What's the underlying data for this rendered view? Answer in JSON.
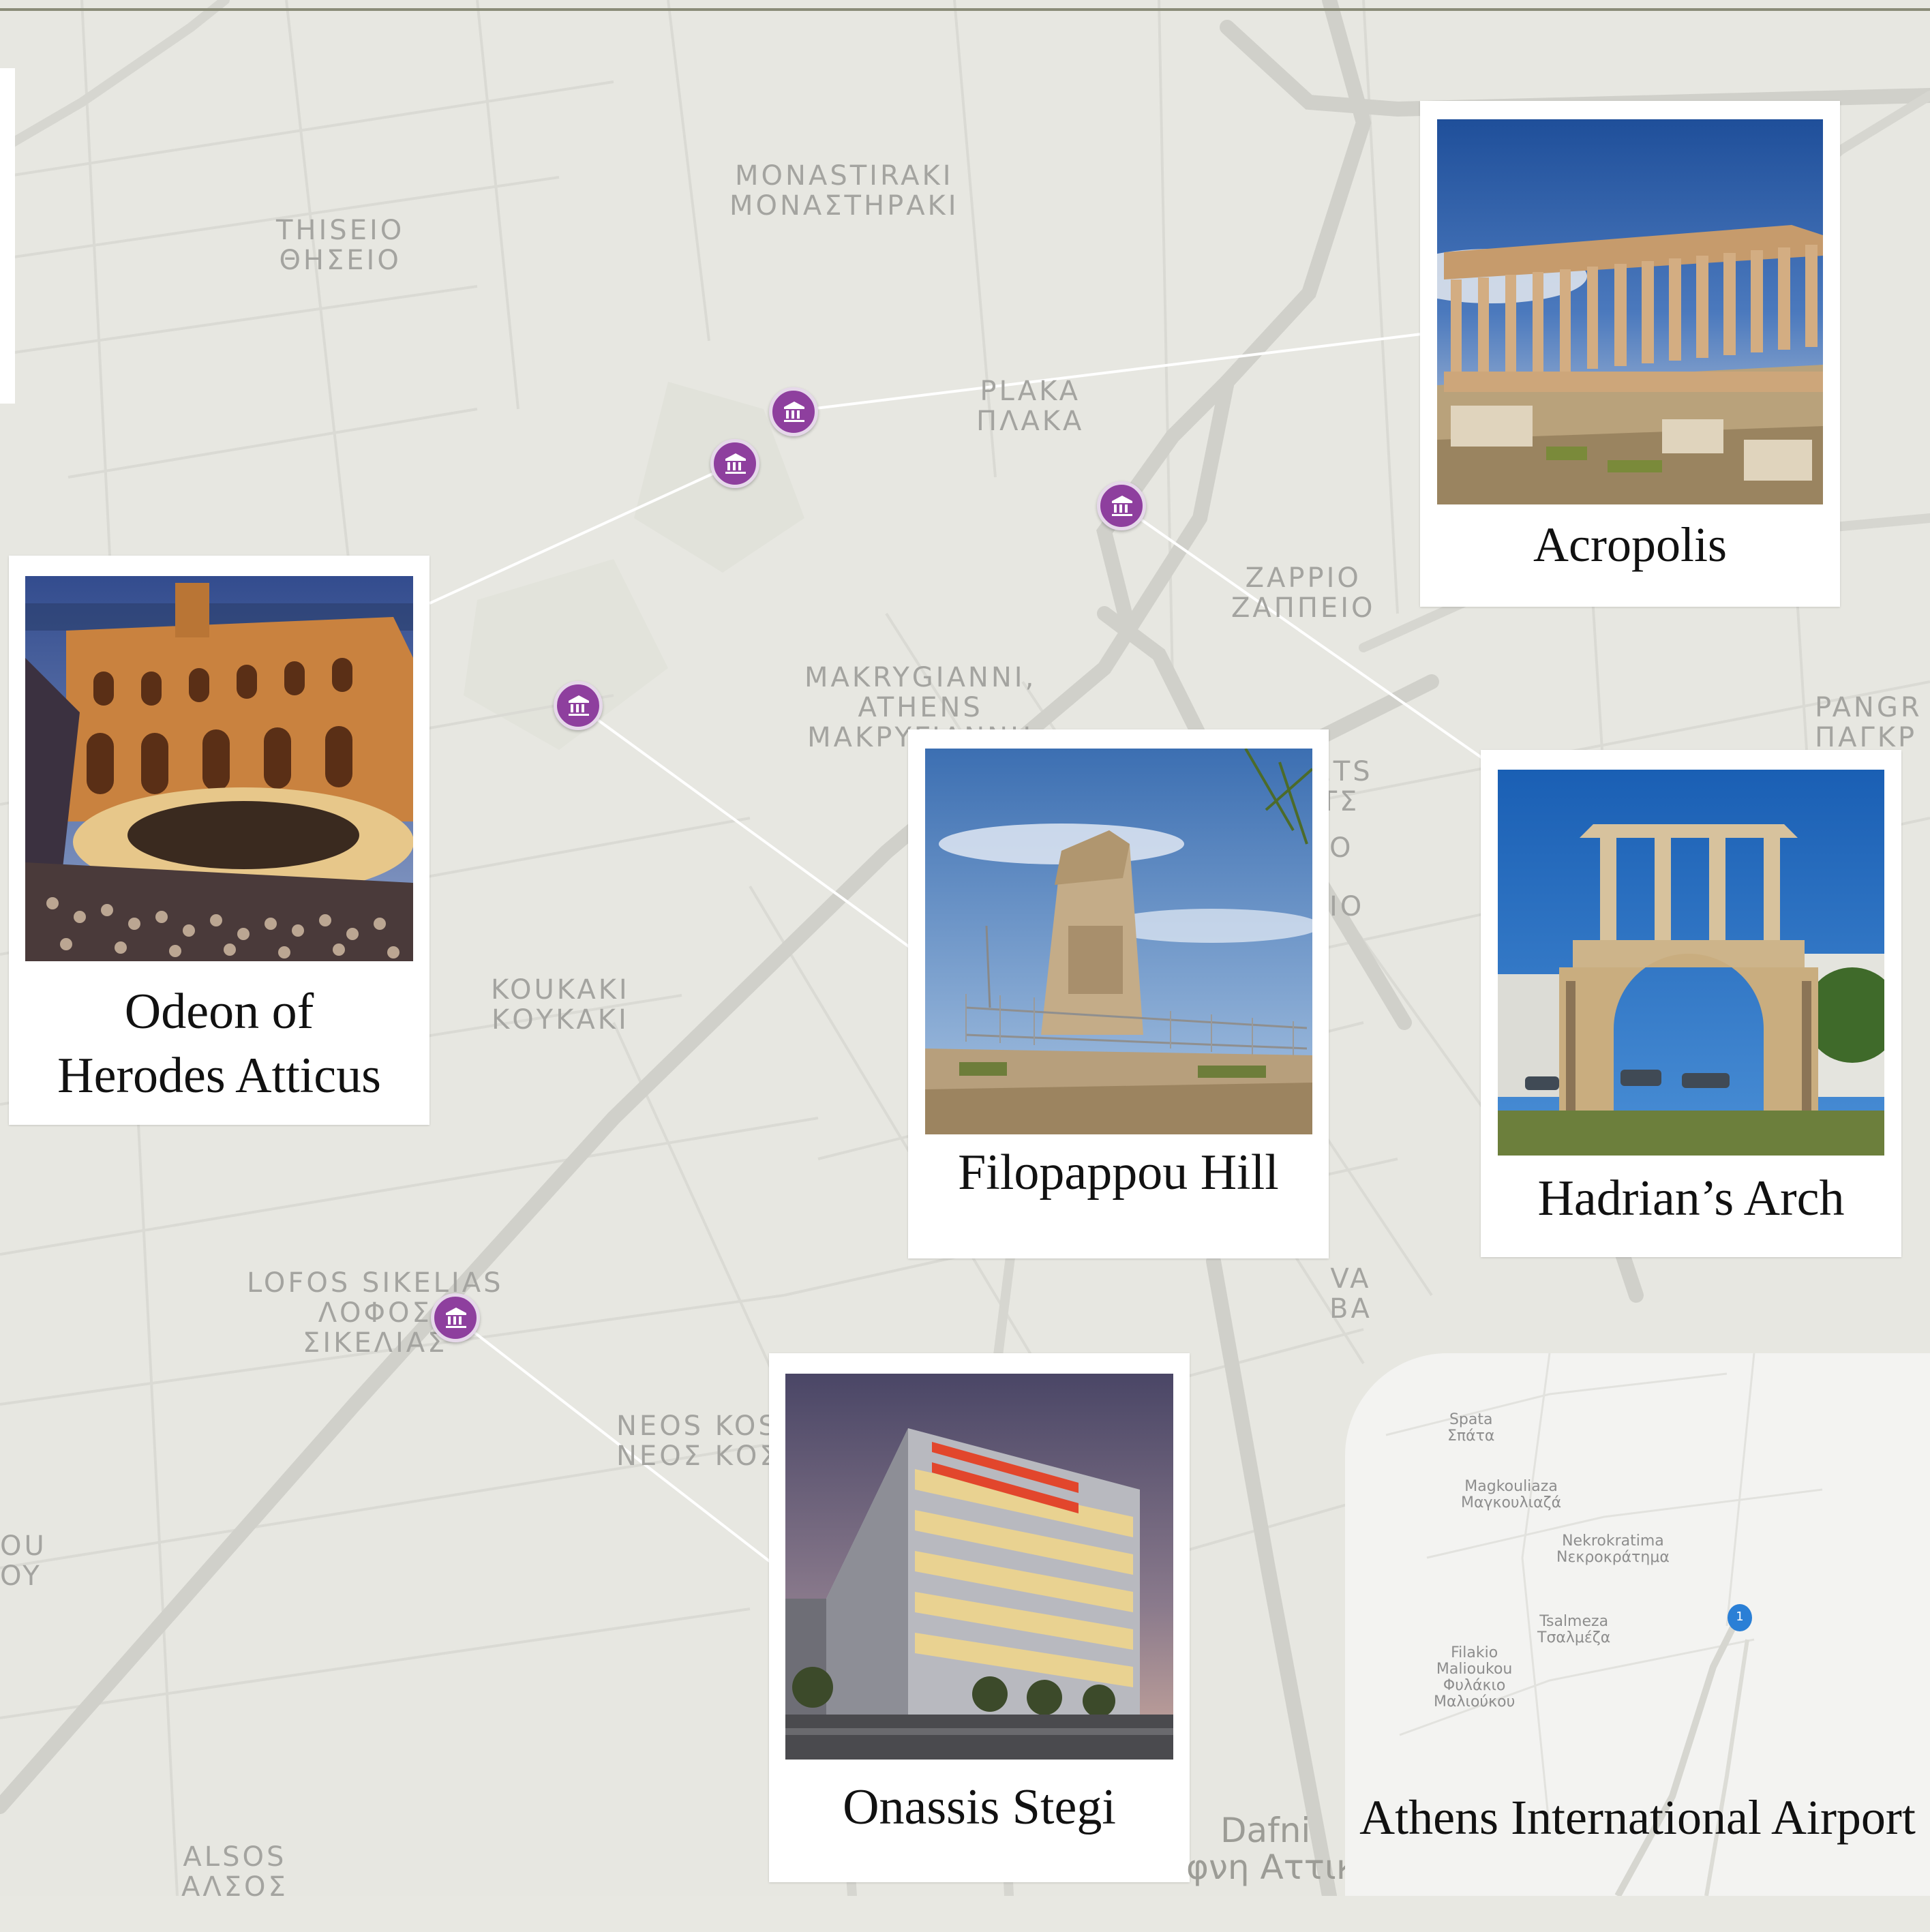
{
  "map": {
    "areas": {
      "thiseio": [
        "THISEIO",
        "ΘΗΣΕΙΟ"
      ],
      "monastiraki": [
        "MONASTIRAKI",
        "ΜΟΝΑΣΤΗΡΑΚΙ"
      ],
      "plaka": [
        "PLAKA",
        "ΠΛΑΚΑ"
      ],
      "zappio": [
        "ZAPPIO",
        "ΖΑΠΠΕΙΟ"
      ],
      "makrygianni": [
        "MAKRYGIANNI,",
        "ATHENS",
        "ΜΑΚΡΥΓΙΑΝΝΗ"
      ],
      "pangrati": [
        "PANGR",
        "ΠΑΓΚΡ"
      ],
      "mets": [
        "METS",
        "ΕΤΣ"
      ],
      "koukaki": [
        "KOUKAKI",
        "ΚΟΥΚΑΚΙ"
      ],
      "lofos_sikelias": [
        "LOFOS SIKELIAS",
        "ΛΟΦΟΣ",
        "ΣΙΚΕΛΙΑΣ"
      ],
      "neos_kosmos": [
        "NEOS KOS",
        "ΝΕΟΣ ΚΟΣ"
      ],
      "alsos": [
        "ALSOS",
        "ΑΛΣΟΣ"
      ],
      "fragment_right_a": "O",
      "fragment_right_b": "IO",
      "fragment_right_c": [
        "VA",
        "BA"
      ],
      "fragment_left": [
        "OU",
        "OY"
      ]
    },
    "dafni": [
      "Dafni",
      "φνη Αττικης"
    ],
    "pin_icon": "museum-icon",
    "pin_color": "#8e3f9e"
  },
  "cards": {
    "acropolis": "Acropolis",
    "odeon": [
      "Odeon of",
      "Herodes Atticus"
    ],
    "filopappou": "Filopappou Hill",
    "hadrian": "Hadrian’s Arch",
    "onassis": "Onassis Stegi"
  },
  "inset": {
    "caption": "Athens International Airport",
    "marker_number": "1",
    "labels": {
      "spata": [
        "Spata",
        "Σπάτα"
      ],
      "magkouliaza": [
        "Magkouliaza",
        "Μαγκουλιαζά"
      ],
      "nekrokratima": [
        "Nekrokratima",
        "Νεκροκράτημα"
      ],
      "tsalmeza": [
        "Tsalmeza",
        "Τσαλμέζα"
      ],
      "filakio": [
        "Filakio",
        "Malioukou",
        "Φυλάκιο",
        "Μαλιούκου"
      ]
    }
  }
}
